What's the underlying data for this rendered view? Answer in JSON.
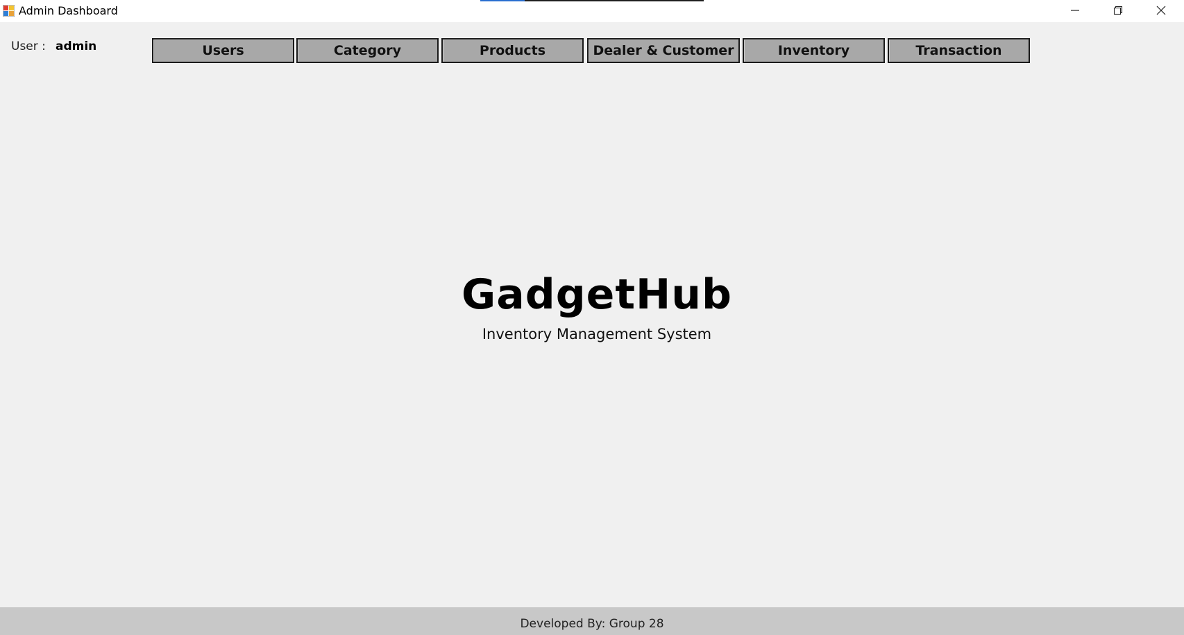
{
  "window": {
    "title": "Admin Dashboard",
    "icon": "app-window-icon",
    "progress": 0.2
  },
  "user": {
    "label": "User :",
    "name": "admin"
  },
  "nav": {
    "users": "Users",
    "category": "Category",
    "products": "Products",
    "dealer_customer": "Dealer & Customer",
    "inventory": "Inventory",
    "transaction": "Transaction"
  },
  "branding": {
    "logo": "GadgetHub",
    "subtitle": "Inventory Management System"
  },
  "footer": {
    "text": "Developed By: Group 28"
  },
  "colors": {
    "background": "#f0f0f0",
    "nav_button": "#a8a8a8",
    "footer": "#c8c8c8",
    "progress_accent": "#2a6fd0"
  }
}
